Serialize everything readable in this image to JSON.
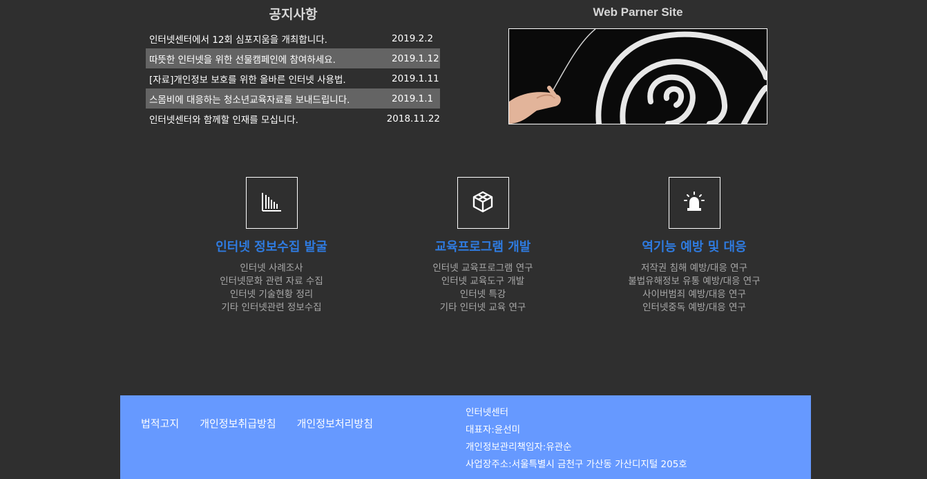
{
  "notice": {
    "title": "공지사항",
    "items": [
      {
        "text": "인터넷센터에서 12회 심포지움을 개최합니다.",
        "date": "2019.2.2"
      },
      {
        "text": "따뜻한 인터넷을 위한 선물캠페인에 참여하세요.",
        "date": "2019.1.12"
      },
      {
        "text": "[자료]개인정보 보호를 위한 올바른 인터넷 사용법.",
        "date": "2019.1.11"
      },
      {
        "text": "스몸비에 대응하는 청소년교육자료를 보내드립니다.",
        "date": "2019.1.1"
      },
      {
        "text": "인터넷센터와 함께할 인재를 모십니다.",
        "date": "2018.11.22"
      }
    ]
  },
  "partner": {
    "title": "Web Parner Site"
  },
  "features": [
    {
      "icon": "bar-chart-icon",
      "title": "인터넷 정보수집 발굴",
      "items": [
        "인터넷 사례조사",
        "인터넷문화 관련 자료 수집",
        "인터넷 기술현황 정리",
        "기타 인터넷관련 정보수집"
      ]
    },
    {
      "icon": "cube-icon",
      "title": "교육프로그램 개발",
      "items": [
        "인터넷 교육프로그램 연구",
        "인터넷 교육도구 개발",
        "인터넷 특강",
        "기타 인터넷 교육 연구"
      ]
    },
    {
      "icon": "alarm-light-icon",
      "title": "역기능 예방 및 대응",
      "items": [
        "저작권 침해 예방/대응 연구",
        "불법유해정보 유통 예방/대응 연구",
        "사이버범죄 예방/대응 연구",
        "인터넷중독 예방/대응 연구"
      ]
    }
  ],
  "footer": {
    "links": [
      "법적고지",
      "개인정보취급방침",
      "개인정보처리방침"
    ],
    "info": [
      "인터넷센터",
      "대표자:윤선미",
      "개인정보관리책임자:유관순",
      "사업장주소:서울특별시 금천구 가산동 가산디지털 205호"
    ]
  },
  "colors": {
    "background": "#2f2f2f",
    "accent_title": "#2f7be0",
    "footer_bg": "#6699ff",
    "notice_alt_row": "#646464"
  }
}
